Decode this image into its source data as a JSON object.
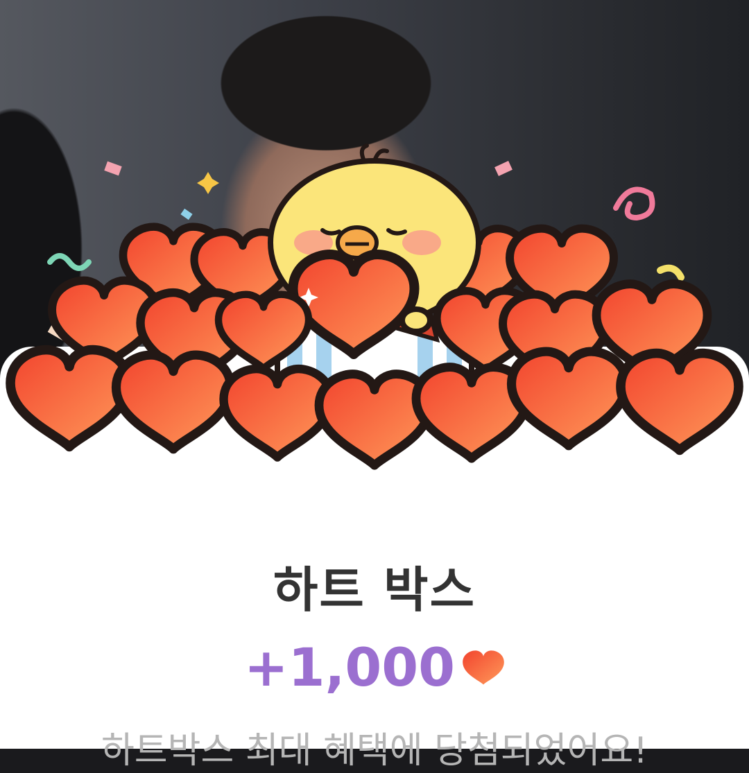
{
  "reward": {
    "title": "하트 박스",
    "amount": "+1,000",
    "currency_icon": "heart-icon",
    "description": "하트박스 최대 혜택에 당첨되었어요!"
  },
  "colors": {
    "amount": "#9b6fd0",
    "title": "#333333",
    "heart": "#f2553d",
    "description": "#b5b5b5"
  }
}
